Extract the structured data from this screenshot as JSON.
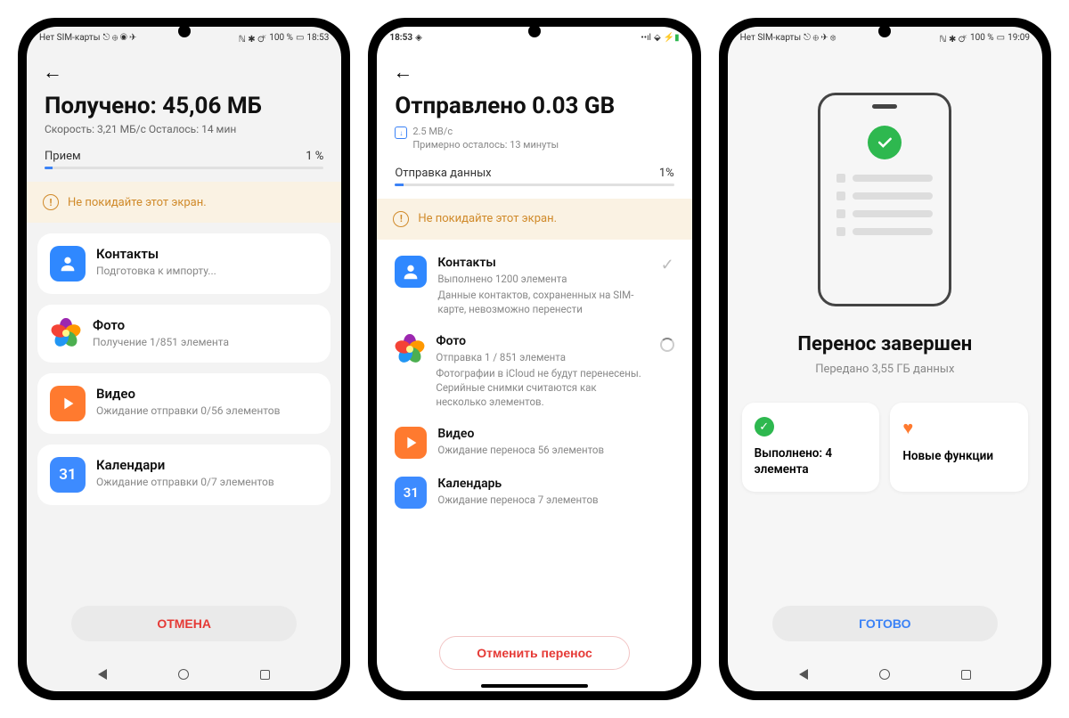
{
  "phone1": {
    "status_left": "Нет SIM-карты",
    "status_right": "100 %",
    "status_time": "18:53",
    "title": "Получено: 45,06 МБ",
    "subtitle": "Скорость: 3,21 МБ/с  Осталось: 14 мин",
    "prog_label": "Прием",
    "prog_value": "1 %",
    "warning": "Не покидайте этот экран.",
    "items": [
      {
        "title": "Контакты",
        "sub": "Подготовка к импорту..."
      },
      {
        "title": "Фото",
        "sub": "Получение 1/851 элемента"
      },
      {
        "title": "Видео",
        "sub": "Ожидание отправки 0/56 элементов"
      },
      {
        "title": "Календари",
        "sub": "Ожидание отправки 0/7 элементов"
      }
    ],
    "cancel": "ОТМЕНА"
  },
  "phone2": {
    "status_time": "18:53",
    "title": "Отправлено 0.03 GB",
    "speed": "2.5 MB/c",
    "remaining": "Примерно осталось: 13 минуты",
    "prog_label": "Отправка данных",
    "prog_value": "1%",
    "warning": "Не покидайте этот экран.",
    "items": [
      {
        "title": "Контакты",
        "sub1": "Выполнено 1200 элемента",
        "sub2": "Данные контактов, сохраненных на SIM-карте, невозможно перенести"
      },
      {
        "title": "Фото",
        "sub1": "Отправка 1 / 851 элемента",
        "sub2": "Фотографии в iCloud не будут перенесены. Серийные снимки считаются как несколько элементов."
      },
      {
        "title": "Видео",
        "sub1": "Ожидание переноса 56 элементов"
      },
      {
        "title": "Календарь",
        "sub1": "Ожидание переноса 7 элементов"
      }
    ],
    "cancel": "Отменить перенос"
  },
  "phone3": {
    "status_left": "Нет SIM-карты",
    "status_right": "100 %",
    "status_time": "19:09",
    "title": "Перенос завершен",
    "subtitle": "Передано 3,55 ГБ данных",
    "card1": "Выполнено: 4 элемента",
    "card2": "Новые функции",
    "done": "ГОТОВО"
  }
}
